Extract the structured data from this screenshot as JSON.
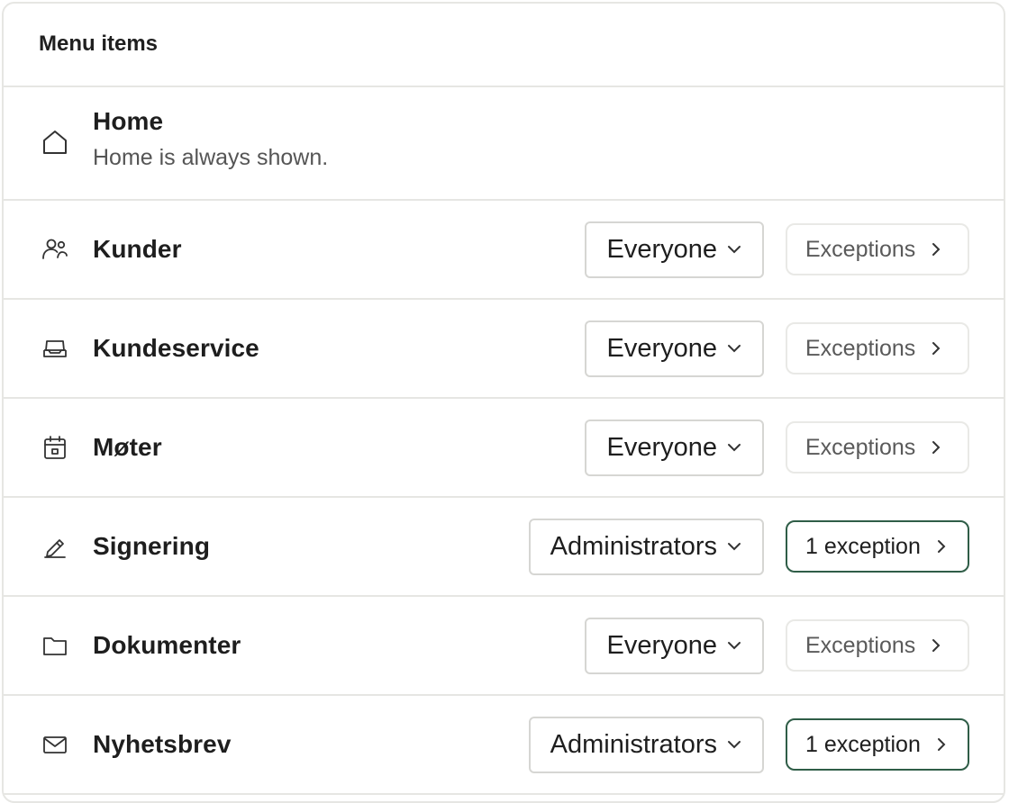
{
  "panel": {
    "title": "Menu items"
  },
  "home": {
    "label": "Home",
    "description": "Home is always shown.",
    "icon": "home-icon"
  },
  "items": [
    {
      "label": "Kunder",
      "icon": "users-icon",
      "visibility": "Everyone",
      "exceptions_label": "Exceptions",
      "has_exceptions": false
    },
    {
      "label": "Kundeservice",
      "icon": "inbox-icon",
      "visibility": "Everyone",
      "exceptions_label": "Exceptions",
      "has_exceptions": false
    },
    {
      "label": "Møter",
      "icon": "calendar-icon",
      "visibility": "Everyone",
      "exceptions_label": "Exceptions",
      "has_exceptions": false
    },
    {
      "label": "Signering",
      "icon": "pen-icon",
      "visibility": "Administrators",
      "exceptions_label": "1 exception",
      "has_exceptions": true
    },
    {
      "label": "Dokumenter",
      "icon": "folder-icon",
      "visibility": "Everyone",
      "exceptions_label": "Exceptions",
      "has_exceptions": false
    },
    {
      "label": "Nyhetsbrev",
      "icon": "mail-icon",
      "visibility": "Administrators",
      "exceptions_label": "1 exception",
      "has_exceptions": true
    }
  ],
  "colors": {
    "border": "#e6e6e3",
    "active_exception_border": "#2f5d47",
    "muted_text": "#5a5a5a"
  }
}
